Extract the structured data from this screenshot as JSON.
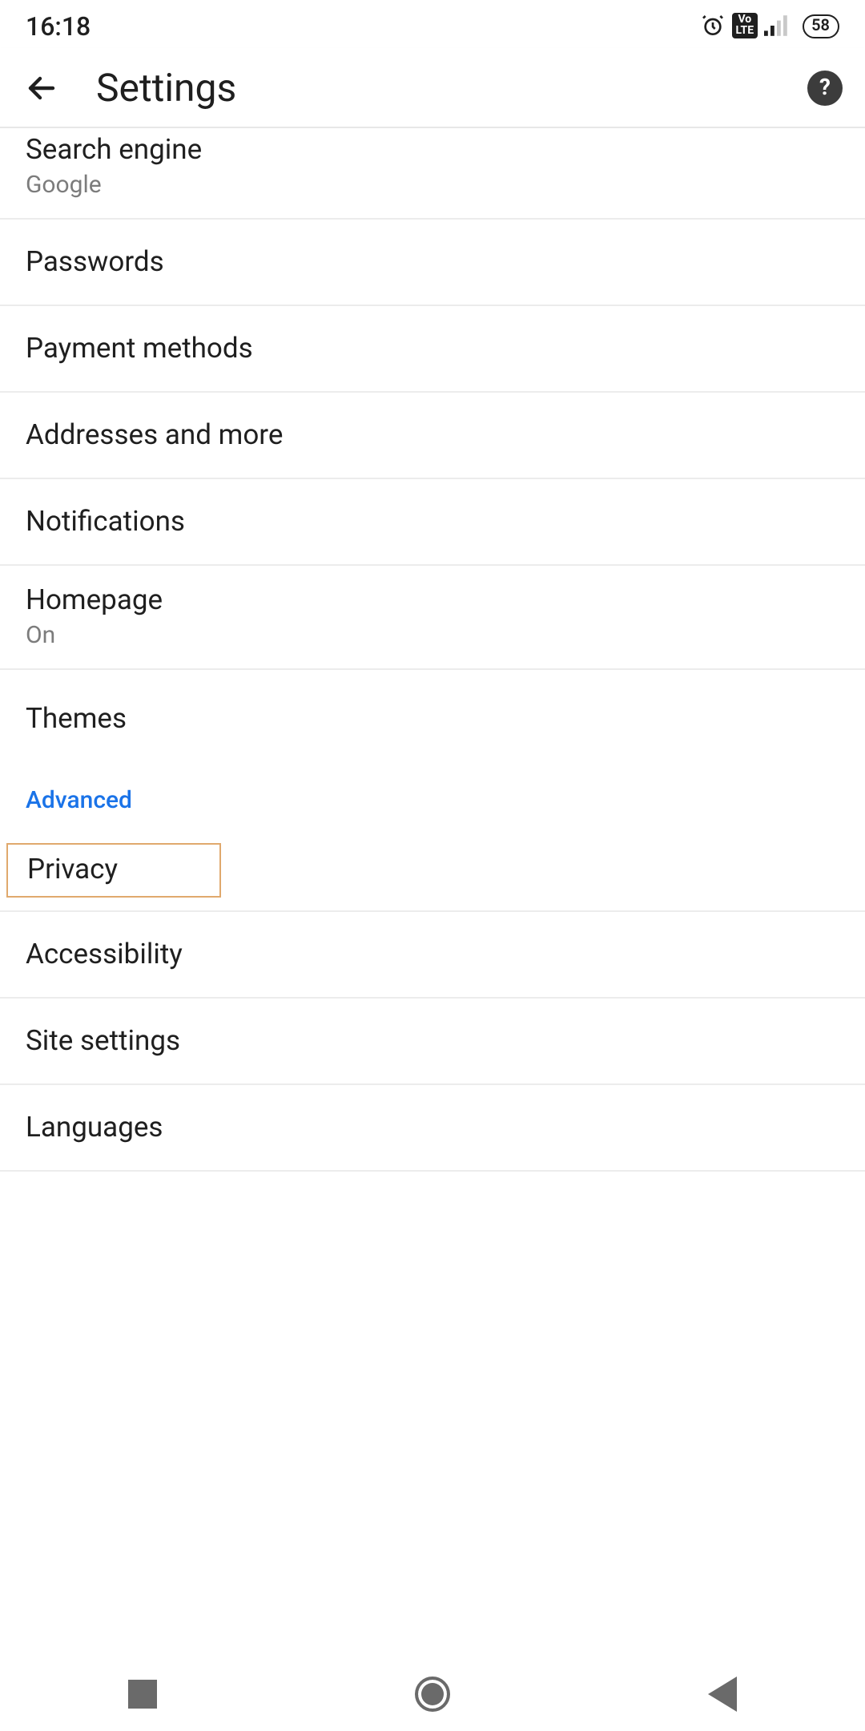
{
  "status": {
    "time": "16:18",
    "battery": "58"
  },
  "header": {
    "title": "Settings"
  },
  "sections": {
    "basics": {
      "searchEngine": {
        "title": "Search engine",
        "value": "Google"
      },
      "passwords": {
        "title": "Passwords"
      },
      "paymentMethods": {
        "title": "Payment methods"
      },
      "addresses": {
        "title": "Addresses and more"
      },
      "notifications": {
        "title": "Notifications"
      },
      "homepage": {
        "title": "Homepage",
        "value": "On"
      },
      "themes": {
        "title": "Themes"
      }
    },
    "advanced": {
      "label": "Advanced",
      "privacy": {
        "title": "Privacy"
      },
      "accessibility": {
        "title": "Accessibility"
      },
      "siteSettings": {
        "title": "Site settings"
      },
      "languages": {
        "title": "Languages"
      }
    }
  }
}
